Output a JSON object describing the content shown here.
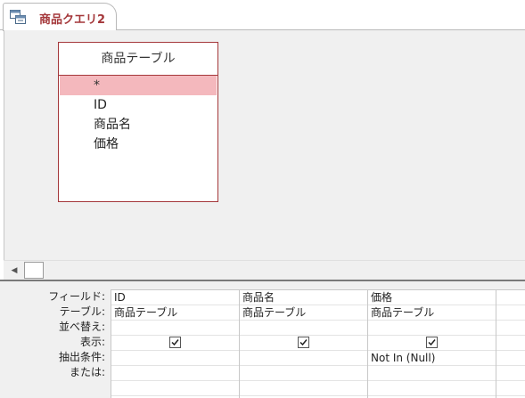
{
  "tab": {
    "title": "商品クエリ2",
    "icon": "query-icon"
  },
  "table": {
    "title": "商品テーブル",
    "fields": [
      "*",
      "ID",
      "商品名",
      "価格"
    ]
  },
  "grid": {
    "row_labels": [
      "フィールド:",
      "テーブル:",
      "並べ替え:",
      "表示:",
      "抽出条件:",
      "または:"
    ],
    "columns": [
      {
        "field": "ID",
        "table": "商品テーブル",
        "sort": "",
        "show": true,
        "criteria": "",
        "or": ""
      },
      {
        "field": "商品名",
        "table": "商品テーブル",
        "sort": "",
        "show": true,
        "criteria": "",
        "or": ""
      },
      {
        "field": "価格",
        "table": "商品テーブル",
        "sort": "",
        "show": true,
        "criteria": "Not In (Null)",
        "or": ""
      }
    ]
  },
  "colors": {
    "accent": "#a4373a",
    "selected_row": "#f4b8bd",
    "pane_bg": "#f0f0f0"
  }
}
